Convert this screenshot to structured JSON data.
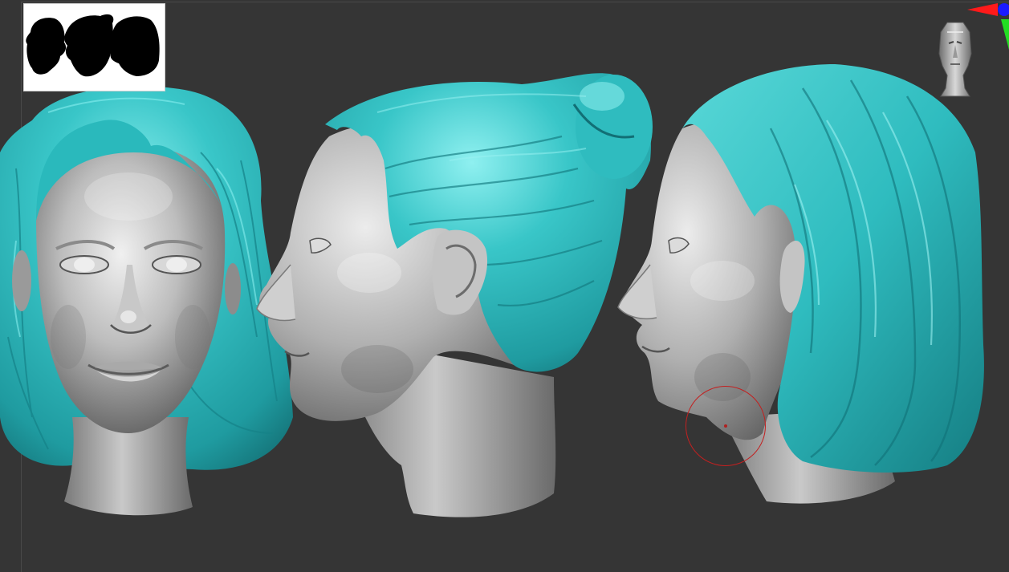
{
  "app": {
    "name": "",
    "viewport_background": "#353535"
  },
  "colors": {
    "hair": "#33c3c3",
    "hair_shadow": "#157b80",
    "hair_highlight": "#9af2f2",
    "skin": "#b4b4b4",
    "skin_shadow": "#5a5a5a",
    "skin_highlight": "#f2f2f2",
    "brush_ring": "#c32020",
    "axis_x": "#ff1a1a",
    "axis_y": "#22dd22",
    "axis_z": "#1a1aff"
  },
  "thumbnail": {
    "icon": "silhouette-reference-icon"
  },
  "models": [
    {
      "view": "front",
      "icon": "head-front-model"
    },
    {
      "view": "side-ponytail",
      "icon": "head-side-ponytail-model"
    },
    {
      "view": "side-long-hair",
      "icon": "head-side-longhair-model"
    }
  ],
  "navigation": {
    "icon": "navigation-head-icon"
  },
  "gizmo": {
    "icon": "axis-gizmo-icon"
  },
  "brush": {
    "icon": "brush-cursor-icon"
  }
}
